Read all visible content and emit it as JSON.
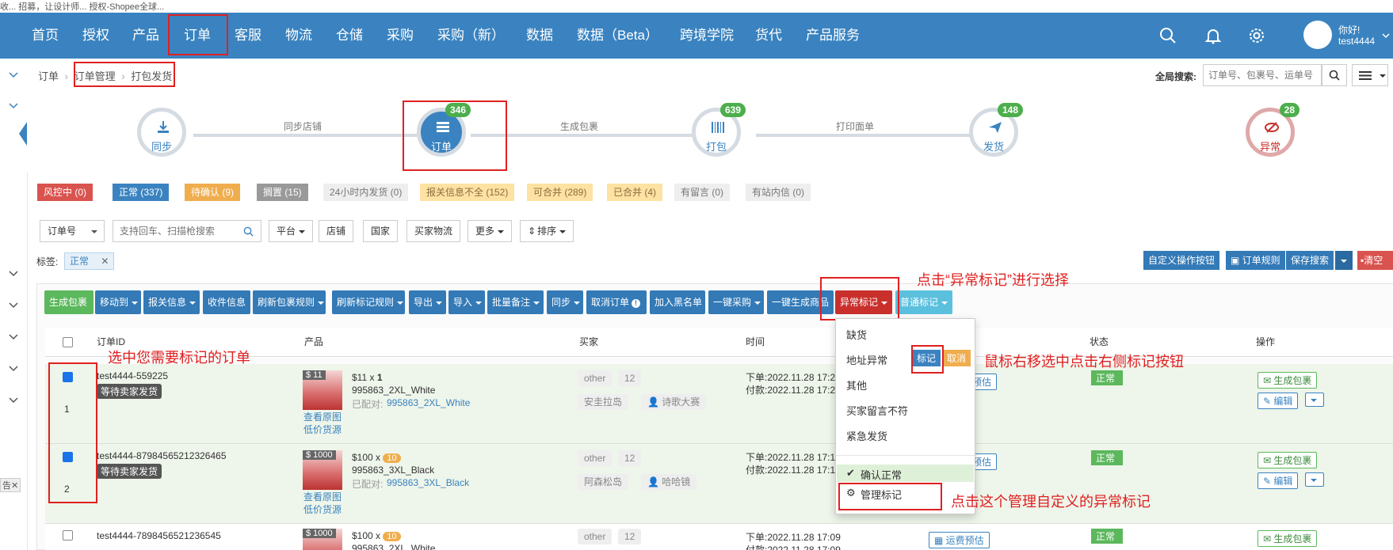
{
  "browser_strip": {
    "text": "收...  招募，让设计师...     授权-Shopee全球..."
  },
  "nav": {
    "items": [
      "首页",
      "授权",
      "产品",
      "订单",
      "客服",
      "物流",
      "仓储",
      "采购",
      "采购（新）",
      "数据",
      "数据（Beta）",
      "跨境学院",
      "货代",
      "产品服务"
    ],
    "greeting": "你好!",
    "user": "test4444"
  },
  "breadcrumb": {
    "items": [
      "订单",
      "订单管理",
      "打包发货"
    ]
  },
  "global_search": {
    "label": "全局搜索:",
    "placeholder": "订单号、包裹号、运单号"
  },
  "workflow": {
    "steps": [
      {
        "label": "同步",
        "badge": ""
      },
      {
        "label": "订单",
        "badge": "346"
      },
      {
        "label": "打包",
        "badge": "639"
      },
      {
        "label": "发货",
        "badge": "148"
      },
      {
        "label": "异常",
        "badge": "28"
      }
    ],
    "transitions": [
      "同步店铺",
      "生成包裹",
      "打印面单"
    ]
  },
  "status_tags": [
    "风控中 (0)",
    "正常 (337)",
    "待确认 (9)",
    "搁置 (15)",
    "24小时内发货 (0)",
    "报关信息不全 (152)",
    "可合并 (289)",
    "已合并 (4)",
    "有留言 (0)",
    "有站内信 (0)"
  ],
  "filters": {
    "order_select": "订单号",
    "search_placeholder": "支持回车、扫描枪搜索",
    "buttons": [
      "平台",
      "店铺",
      "国家",
      "买家物流",
      "更多",
      "排序"
    ]
  },
  "tag_filter": {
    "label": "标签:",
    "value": "正常"
  },
  "right_actions": [
    "自定义操作按钮",
    "订单规则",
    "保存搜索",
    "清空"
  ],
  "toolbar": {
    "buttons": [
      "生成包裹",
      "移动到",
      "报关信息",
      "收件信息",
      "刷新包裹规则",
      "刷新标记规则",
      "导出",
      "导入",
      "批量备注",
      "同步",
      "取消订单",
      "加入黑名单",
      "一键采购",
      "一键生成商品",
      "异常标记",
      "普通标记"
    ]
  },
  "table": {
    "headers": [
      "订单ID",
      "产品",
      "买家",
      "时间",
      "状态",
      "操作"
    ],
    "rows": [
      {
        "checked": true,
        "index": "1",
        "order_id": "test4444-559225",
        "status_badge": "等待卖家发货",
        "price_tag": "$ 11",
        "price": "$11",
        "qty": "1",
        "sku": "995863_2XL_White",
        "matched_label": "已配对:",
        "matched": "995863_2XL_White",
        "img_links": [
          "查看原图",
          "低价货源"
        ],
        "platform": "other",
        "pill_num": "12",
        "region": "安圭拉岛",
        "buyer": "诗歌大赛",
        "order_time": "下单:2022.11.28 17:2",
        "pay_time": "付款:2022.11.28 17:2",
        "freight": "预估",
        "status": "正常",
        "action_main": "生成包裹",
        "action_edit": "编辑"
      },
      {
        "checked": true,
        "index": "2",
        "order_id": "test4444-87984565212326465",
        "status_badge": "等待卖家发货",
        "price_tag": "$ 1000",
        "price": "$100",
        "qty": "10",
        "sku": "995863_3XL_Black",
        "matched_label": "已配对:",
        "matched": "995863_3XL_Black",
        "img_links": [
          "查看原图",
          "低价货源"
        ],
        "platform": "other",
        "pill_num": "12",
        "region": "阿森松岛",
        "buyer": "哈哈镜",
        "order_time": "下单:2022.11.28 17:1",
        "pay_time": "付款:2022.11.28 17:1",
        "freight": "预估",
        "status": "正常",
        "action_main": "生成包裹",
        "action_edit": "编辑"
      },
      {
        "checked": false,
        "index": "",
        "order_id": "test4444-7898456521236545",
        "status_badge": "",
        "price_tag": "$ 1000",
        "price": "$100",
        "qty": "10",
        "sku": "995863_2XL_White",
        "matched_label": "",
        "matched": "",
        "img_links": [],
        "platform": "other",
        "pill_num": "12",
        "region": "",
        "buyer": "",
        "order_time": "下单:2022.11.28 17:09",
        "pay_time": "付款:2022.11.28 17:09",
        "freight": "运费预估",
        "status": "正常",
        "action_main": "生成包裹",
        "action_edit": ""
      }
    ]
  },
  "dropdown": {
    "items": [
      "缺货",
      "地址异常",
      "其他",
      "买家留言不符",
      "紧急发货"
    ],
    "mark_label": "标记",
    "cancel_label": "取消",
    "confirm": "确认正常",
    "manage": "管理标记"
  },
  "annotations": {
    "click_abnormal": "点击“异常标记”进行选择",
    "select_orders": "选中您需要标记的订单",
    "hover_mark": "鼠标右移选中点击右侧标记按钮",
    "manage_custom": "点击这个管理自定义的异常标记"
  },
  "colors": {
    "nav": "#3a83c0",
    "annotation": "#e02020",
    "success": "#5cb85c",
    "danger": "#c9302c",
    "warning": "#f0ad4e"
  },
  "left_popup": {
    "text": "告✕"
  }
}
